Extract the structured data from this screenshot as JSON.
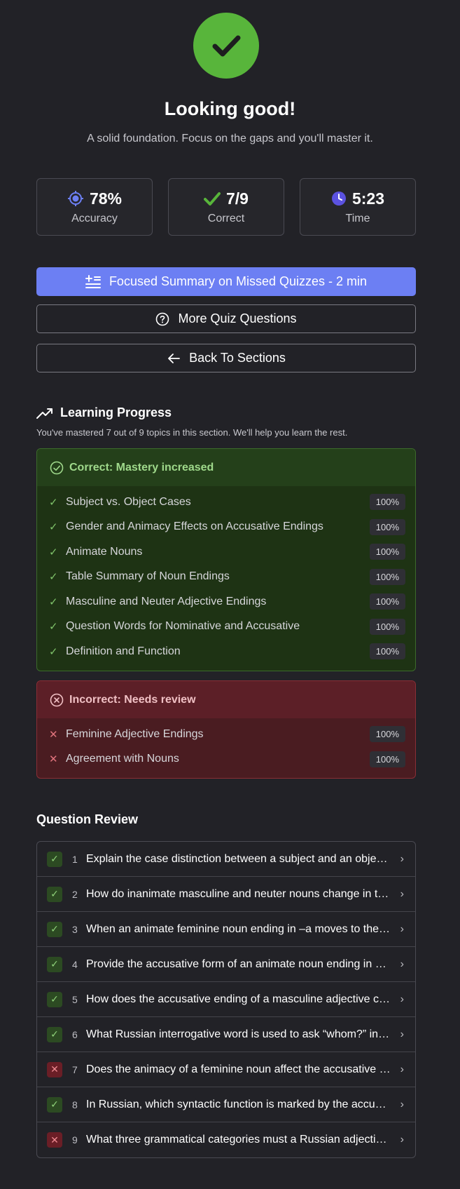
{
  "header": {
    "icon": "check-icon",
    "title": "Looking good!",
    "subtitle": "A solid foundation. Focus on the gaps and you'll master it."
  },
  "stats": [
    {
      "icon": "target-icon",
      "value": "78%",
      "label": "Accuracy"
    },
    {
      "icon": "check-icon",
      "value": "7/9",
      "label": "Correct"
    },
    {
      "icon": "clock-icon",
      "value": "5:23",
      "label": "Time"
    }
  ],
  "actions": {
    "focused_summary": "Focused Summary on Missed Quizzes - 2 min",
    "more_quiz": "More Quiz Questions",
    "back": "Back To Sections"
  },
  "learning_progress": {
    "title": "Learning Progress",
    "description": "You've mastered 7 out of 9 topics in this section. We'll help you learn the rest.",
    "correct": {
      "heading": "Correct: Mastery increased",
      "topics": [
        {
          "label": "Subject vs. Object Cases",
          "percent": "100%"
        },
        {
          "label": "Gender and Animacy Effects on Accusative Endings",
          "percent": "100%"
        },
        {
          "label": "Animate Nouns",
          "percent": "100%"
        },
        {
          "label": "Table Summary of Noun Endings",
          "percent": "100%"
        },
        {
          "label": "Masculine and Neuter Adjective Endings",
          "percent": "100%"
        },
        {
          "label": "Question Words for Nominative and Accusative",
          "percent": "100%"
        },
        {
          "label": "Definition and Function",
          "percent": "100%"
        }
      ]
    },
    "incorrect": {
      "heading": "Incorrect: Needs review",
      "topics": [
        {
          "label": "Feminine Adjective Endings",
          "percent": "100%"
        },
        {
          "label": "Agreement with Nouns",
          "percent": "100%"
        }
      ]
    }
  },
  "question_review": {
    "title": "Question Review",
    "questions": [
      {
        "num": "1",
        "correct": true,
        "text": "Explain the case distinction between a subject and an object in Russian grammar."
      },
      {
        "num": "2",
        "correct": true,
        "text": "How do inanimate masculine and neuter nouns change in the accusative case?"
      },
      {
        "num": "3",
        "correct": true,
        "text": "When an animate feminine noun ending in –a moves to the accusative, what happens?"
      },
      {
        "num": "4",
        "correct": true,
        "text": "Provide the accusative form of an animate noun ending in a consonant."
      },
      {
        "num": "5",
        "correct": true,
        "text": "How does the accusative ending of a masculine adjective change with animacy?"
      },
      {
        "num": "6",
        "correct": true,
        "text": "What Russian interrogative word is used to ask “whom?” in the accusative?"
      },
      {
        "num": "7",
        "correct": false,
        "text": "Does the animacy of a feminine noun affect the accusative adjective ending?"
      },
      {
        "num": "8",
        "correct": true,
        "text": "In Russian, which syntactic function is marked by the accusative case?"
      },
      {
        "num": "9",
        "correct": false,
        "text": "What three grammatical categories must a Russian adjective agree with?"
      }
    ]
  },
  "colors": {
    "background": "#222227",
    "success": "#58b53b",
    "primary": "#6c7ff3",
    "danger": "#e0737c"
  }
}
